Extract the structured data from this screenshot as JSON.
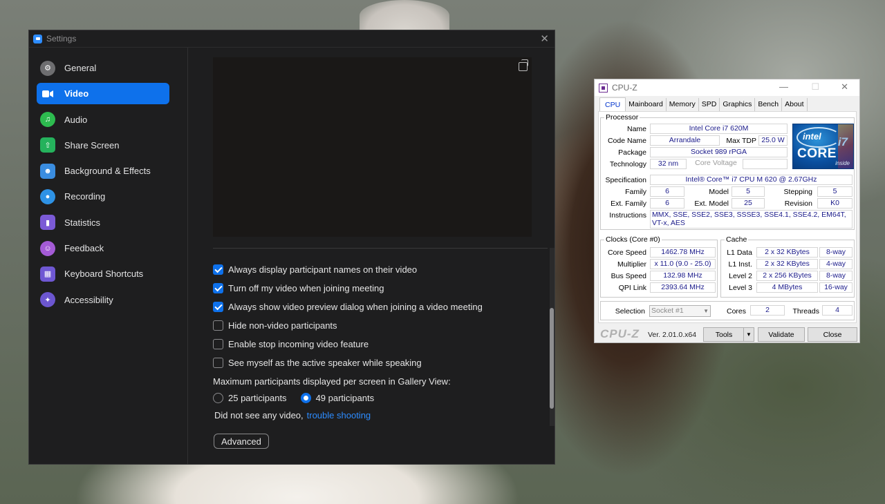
{
  "zoom": {
    "title": "Settings",
    "nav": [
      {
        "label": "General",
        "icon": "gear-icon",
        "glyph": "⚙"
      },
      {
        "label": "Video",
        "icon": "video-camera-icon",
        "glyph": ""
      },
      {
        "label": "Audio",
        "icon": "headphones-icon",
        "glyph": "♫"
      },
      {
        "label": "Share Screen",
        "icon": "share-screen-icon",
        "glyph": "⇧"
      },
      {
        "label": "Background & Effects",
        "icon": "background-effects-icon",
        "glyph": "☻"
      },
      {
        "label": "Recording",
        "icon": "recording-icon",
        "glyph": "●"
      },
      {
        "label": "Statistics",
        "icon": "statistics-icon",
        "glyph": "▮"
      },
      {
        "label": "Feedback",
        "icon": "feedback-icon",
        "glyph": "☺"
      },
      {
        "label": "Keyboard Shortcuts",
        "icon": "keyboard-icon",
        "glyph": "▦"
      },
      {
        "label": "Accessibility",
        "icon": "accessibility-icon",
        "glyph": "✦"
      }
    ],
    "active_nav": "Video",
    "options": [
      {
        "label": "Always display participant names on their video",
        "checked": true
      },
      {
        "label": "Turn off my video when joining meeting",
        "checked": true
      },
      {
        "label": "Always show video preview dialog when joining a video meeting",
        "checked": true
      },
      {
        "label": "Hide non-video participants",
        "checked": false
      },
      {
        "label": "Enable stop incoming video feature",
        "checked": false
      },
      {
        "label": "See myself as the active speaker while speaking",
        "checked": false
      }
    ],
    "gallery_label": "Maximum participants displayed per screen in Gallery View:",
    "radio": [
      {
        "label": "25 participants",
        "selected": false
      },
      {
        "label": "49 participants",
        "selected": true
      }
    ],
    "no_video_text": "Did not see any video,",
    "troubleshoot_link": "trouble shooting",
    "advanced_button": "Advanced"
  },
  "cpuz": {
    "title": "CPU-Z",
    "tabs": [
      "CPU",
      "Mainboard",
      "Memory",
      "SPD",
      "Graphics",
      "Bench",
      "About"
    ],
    "active_tab": "CPU",
    "processor_group": "Processor",
    "labels": {
      "name": "Name",
      "codename": "Code Name",
      "maxtdp": "Max TDP",
      "package": "Package",
      "technology": "Technology",
      "core_voltage": "Core Voltage",
      "specification": "Specification",
      "family": "Family",
      "model": "Model",
      "stepping": "Stepping",
      "ext_family": "Ext. Family",
      "ext_model": "Ext. Model",
      "revision": "Revision",
      "instructions": "Instructions",
      "core_speed": "Core Speed",
      "multiplier": "Multiplier",
      "bus_speed": "Bus Speed",
      "qpi_link": "QPI Link",
      "l1d": "L1 Data",
      "l1i": "L1 Inst.",
      "l2": "Level 2",
      "l3": "Level 3",
      "selection": "Selection",
      "cores": "Cores",
      "threads": "Threads"
    },
    "values": {
      "name": "Intel Core i7 620M",
      "codename": "Arrandale",
      "maxtdp": "25.0 W",
      "package": "Socket 989 rPGA",
      "technology": "32 nm",
      "specification": "Intel® Core™ i7 CPU       M 620  @ 2.67GHz",
      "family": "6",
      "model": "5",
      "stepping": "5",
      "ext_family": "6",
      "ext_model": "25",
      "revision": "K0",
      "instructions": "MMX, SSE, SSE2, SSE3, SSSE3, SSE4.1, SSE4.2, EM64T, VT-x, AES",
      "core_speed": "1462.78 MHz",
      "multiplier": "x 11.0 (9.0 - 25.0)",
      "bus_speed": "132.98 MHz",
      "qpi_link": "2393.64 MHz",
      "l1d": "2 x 32 KBytes",
      "l1d_way": "8-way",
      "l1i": "2 x 32 KBytes",
      "l1i_way": "4-way",
      "l2": "2 x 256 KBytes",
      "l2_way": "8-way",
      "l3": "4 MBytes",
      "l3_way": "16-way",
      "selection": "Socket #1",
      "cores": "2",
      "threads": "4"
    },
    "clocks_group": "Clocks (Core #0)",
    "cache_group": "Cache",
    "logo": {
      "brand": "intel",
      "line": "CORE",
      "model": "i7",
      "tag": "inside"
    },
    "brand": "CPU-Z",
    "version": "Ver. 2.01.0.x64",
    "buttons": {
      "tools": "Tools",
      "validate": "Validate",
      "close": "Close"
    }
  }
}
